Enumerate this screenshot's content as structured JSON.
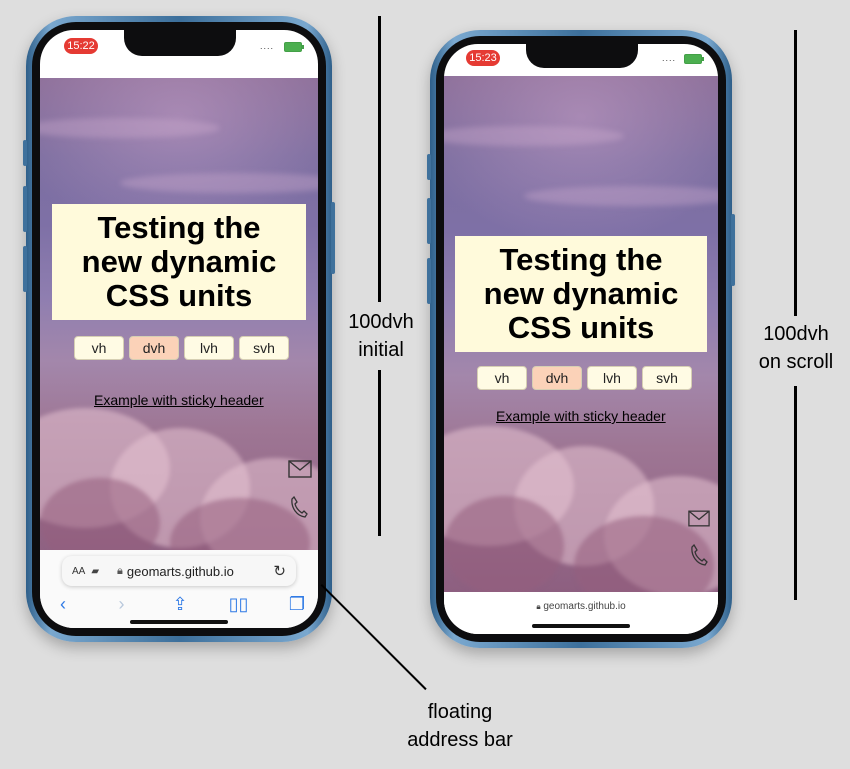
{
  "phones": [
    {
      "status_time": "15:22",
      "title_lines": [
        "Testing the",
        "new dynamic",
        "CSS units"
      ],
      "unit_buttons": [
        {
          "label": "vh",
          "active": false
        },
        {
          "label": "dvh",
          "active": true
        },
        {
          "label": "lvh",
          "active": false
        },
        {
          "label": "svh",
          "active": false
        }
      ],
      "link_text": "Example with sticky header",
      "address_bar": {
        "aa_label": "AA",
        "url": "geomarts.github.io"
      },
      "annotation": {
        "line1": "100dvh",
        "line2": "initial"
      }
    },
    {
      "status_time": "15:23",
      "title_lines": [
        "Testing the",
        "new dynamic",
        "CSS units"
      ],
      "unit_buttons": [
        {
          "label": "vh",
          "active": false
        },
        {
          "label": "dvh",
          "active": true
        },
        {
          "label": "lvh",
          "active": false
        },
        {
          "label": "svh",
          "active": false
        }
      ],
      "link_text": "Example with sticky header",
      "compact_url": "geomarts.github.io",
      "annotation": {
        "line1": "100dvh",
        "line2": "on scroll"
      }
    }
  ],
  "callout": {
    "line1": "floating",
    "line2": "address bar"
  },
  "colors": {
    "status_pill": "#e53a33",
    "title_box": "#fffadb",
    "active_button": "#fbd2b8",
    "safari_blue": "#2f7ae5",
    "frame_blue": "#3c6f9b"
  },
  "icons": [
    "mail-icon",
    "phone-icon",
    "lock-icon",
    "reload-icon",
    "back-icon",
    "forward-icon",
    "share-icon",
    "bookmarks-icon",
    "tabs-icon"
  ]
}
